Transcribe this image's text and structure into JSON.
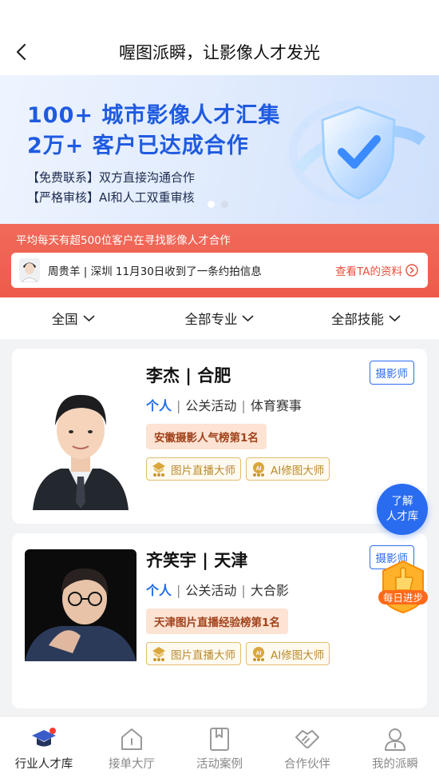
{
  "nav": {
    "title": "喔图派瞬，让影像人才发光"
  },
  "banner": {
    "headline1": "100+ 城市影像人才汇集",
    "headline2": "2万+ 客户已达成合作",
    "line1": "【免费联系】双方直接沟通合作",
    "line2": "【严格审核】AI和人工双重审核",
    "slide_count": 2,
    "active_slide": 1
  },
  "promo": {
    "title": "平均每天有超500位客户在寻找影像人才合作",
    "message": "周贵羊 | 深圳 11月30日收到了一条约拍信息",
    "link": "查看TA的资料"
  },
  "filters": [
    {
      "label": "全国"
    },
    {
      "label": "全部专业"
    },
    {
      "label": "全部技能"
    }
  ],
  "talents": [
    {
      "name": "李杰 | 合肥",
      "role": "摄影师",
      "type": "个人",
      "fields": [
        "公关活动",
        "体育赛事"
      ],
      "rank": "安徽摄影人气榜第1名",
      "badges": [
        "图片直播大师",
        "AI修图大师"
      ]
    },
    {
      "name": "齐笑宇 | 天津",
      "role": "摄影师",
      "type": "个人",
      "fields": [
        "公关活动",
        "大合影"
      ],
      "rank": "天津图片直播经验榜第1名",
      "badges": [
        "图片直播大师",
        "AI修图大师"
      ]
    }
  ],
  "float_button": {
    "line1": "了解",
    "line2": "人才库"
  },
  "daily_badge": {
    "label": "每日进步"
  },
  "tabbar": [
    {
      "label": "行业人才库",
      "icon": "graduation-cap-icon",
      "active": true
    },
    {
      "label": "接单大厅",
      "icon": "house-icon",
      "active": false
    },
    {
      "label": "活动案例",
      "icon": "bookmark-icon",
      "active": false
    },
    {
      "label": "合作伙伴",
      "icon": "handshake-icon",
      "active": false
    },
    {
      "label": "我的派瞬",
      "icon": "user-icon",
      "active": false
    }
  ],
  "colors": {
    "brand_blue": "#2a6cf0",
    "promo_red": "#ef5a4a",
    "rank_bg": "#fde3d3",
    "badge_gold": "#e2bc6c"
  }
}
